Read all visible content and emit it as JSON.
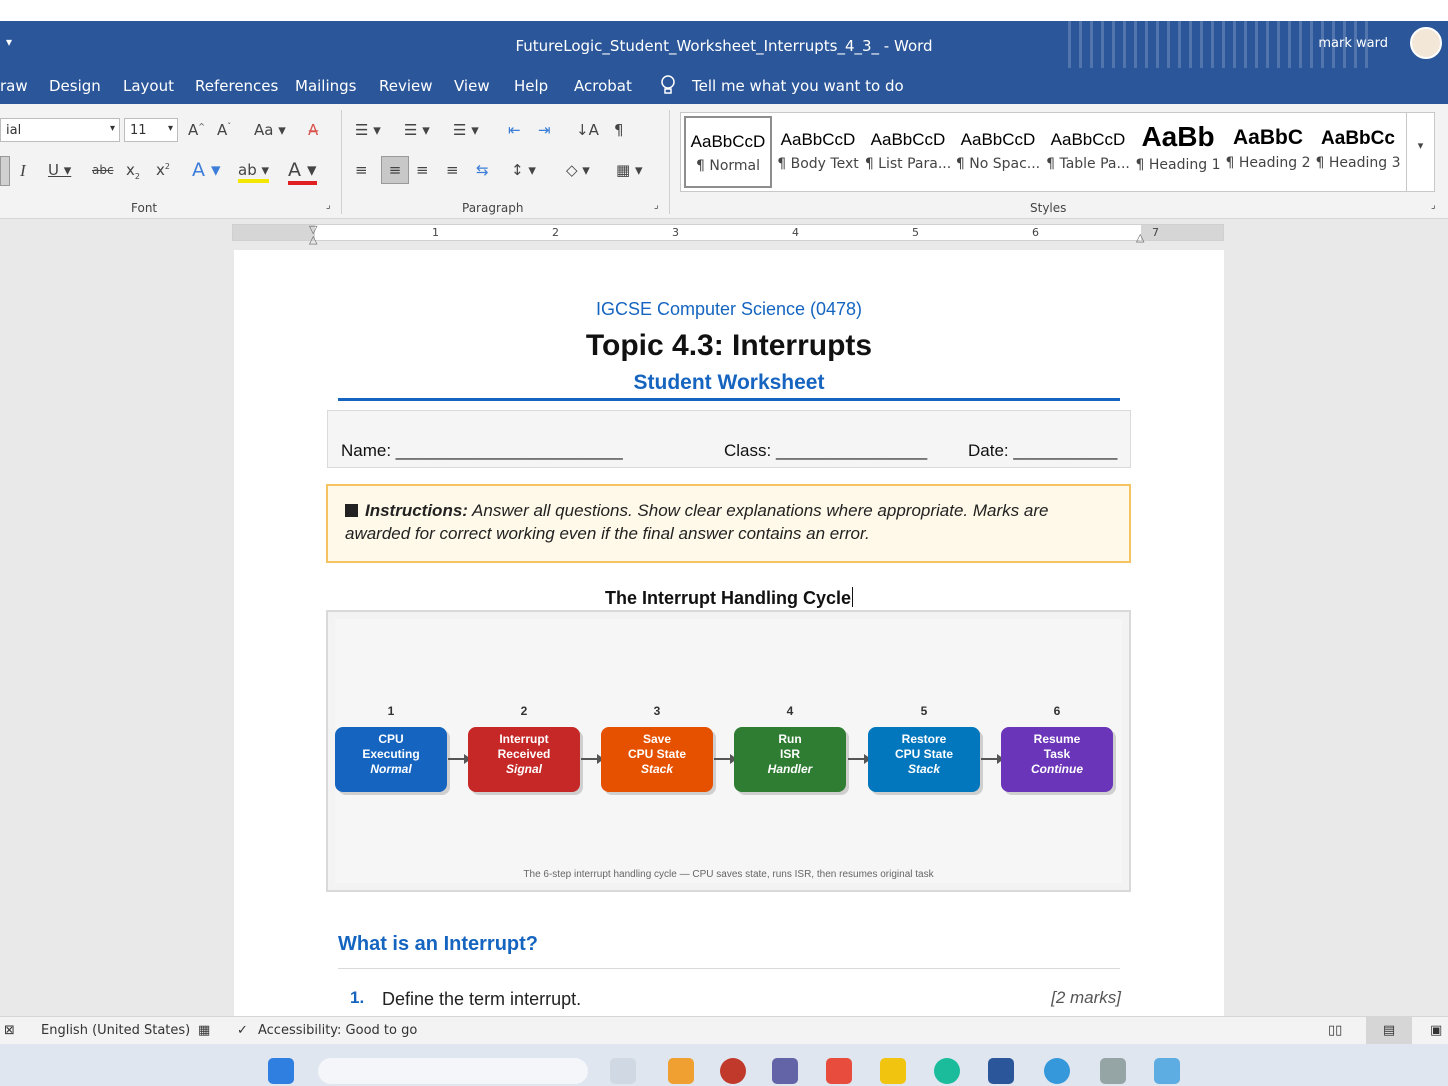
{
  "window": {
    "title": "FutureLogic_Student_Worksheet_Interrupts_4_3_  -  Word",
    "user": "mark ward"
  },
  "tabs": [
    "raw",
    "Design",
    "Layout",
    "References",
    "Mailings",
    "Review",
    "View",
    "Help",
    "Acrobat"
  ],
  "tell_me": "Tell me what you want to do",
  "ribbon": {
    "font_name": "ial",
    "font_size": "11",
    "font_group": "Font",
    "paragraph_group": "Paragraph",
    "styles_group": "Styles",
    "styles": [
      {
        "sample": "AaBbCcD",
        "name": "¶ Normal"
      },
      {
        "sample": "AaBbCcD",
        "name": "¶ Body Text"
      },
      {
        "sample": "AaBbCcD",
        "name": "¶ List Para..."
      },
      {
        "sample": "AaBbCcD",
        "name": "¶ No Spac..."
      },
      {
        "sample": "AaBbCcD",
        "name": "¶ Table Pa..."
      },
      {
        "sample": "AaBb",
        "name": "¶ Heading 1"
      },
      {
        "sample": "AaBbC",
        "name": "¶ Heading 2"
      },
      {
        "sample": "AaBbCc",
        "name": "¶ Heading 3"
      }
    ]
  },
  "ruler": {
    "numbers": [
      "1",
      "2",
      "3",
      "4",
      "5",
      "6",
      "7"
    ]
  },
  "document": {
    "subject": "IGCSE Computer Science (0478)",
    "title": "Topic 4.3: Interrupts",
    "subtitle": "Student Worksheet",
    "name_label": "Name: ________________________",
    "class_label": "Class: ________________",
    "date_label": "Date: ___________",
    "instructions_label": "Instructions:",
    "instructions_text": " Answer all questions. Show clear explanations where appropriate. Marks are awarded for correct working even if the final answer contains an error.",
    "cycle_heading": "The Interrupt Handling Cycle",
    "steps": [
      {
        "num": "1",
        "line1": "CPU",
        "line2": "Executing",
        "sub": "Normal",
        "color": "#1565c0"
      },
      {
        "num": "2",
        "line1": "Interrupt",
        "line2": "Received",
        "sub": "Signal",
        "color": "#c62828"
      },
      {
        "num": "3",
        "line1": "Save",
        "line2": "CPU State",
        "sub": "Stack",
        "color": "#e65100"
      },
      {
        "num": "4",
        "line1": "Run",
        "line2": "ISR",
        "sub": "Handler",
        "color": "#2e7d32"
      },
      {
        "num": "5",
        "line1": "Restore",
        "line2": "CPU State",
        "sub": "Stack",
        "color": "#0277bd"
      },
      {
        "num": "6",
        "line1": "Resume",
        "line2": "Task",
        "sub": "Continue",
        "color": "#6a35b8"
      }
    ],
    "diagram_caption": "The 6-step interrupt handling cycle — CPU saves state, runs ISR, then resumes original task",
    "section_heading": "What is an Interrupt?",
    "question_number": "1.",
    "question_text": "Define the term interrupt.",
    "question_marks": "[2 marks]"
  },
  "status": {
    "language": "English (United States)",
    "accessibility": "Accessibility: Good to go"
  }
}
